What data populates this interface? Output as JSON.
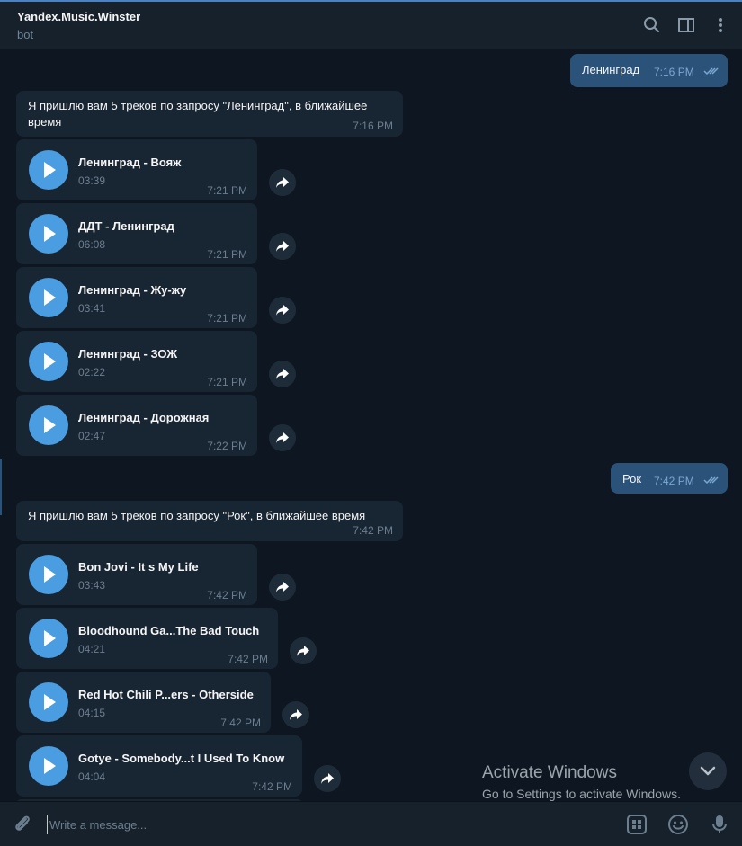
{
  "header": {
    "title": "Yandex.Music.Winster",
    "subtitle": "bot",
    "icons": [
      "search-icon",
      "sidebar-toggle-icon",
      "more-vertical-icon"
    ]
  },
  "messages": {
    "out1": {
      "text": "Ленинград",
      "time": "7:16 PM"
    },
    "in1": {
      "text_line1": "Я пришлю вам 5 треков по запросу \"Ленинград\", в ближайшее",
      "text_line2": "время",
      "time": "7:16 PM"
    },
    "tracks1": [
      {
        "title": "Ленинград - Вояж",
        "duration": "03:39",
        "time": "7:21 PM"
      },
      {
        "title": "ДДТ - Ленинград",
        "duration": "06:08",
        "time": "7:21 PM"
      },
      {
        "title": "Ленинград - Жу-жу",
        "duration": "03:41",
        "time": "7:21 PM"
      },
      {
        "title": "Ленинград - ЗОЖ",
        "duration": "02:22",
        "time": "7:21 PM"
      },
      {
        "title": "Ленинград - Дорожная",
        "duration": "02:47",
        "time": "7:22 PM"
      }
    ],
    "out2": {
      "text": "Рок",
      "time": "7:42 PM"
    },
    "in2": {
      "text": "Я пришлю вам 5 треков по запросу \"Рок\", в ближайшее время",
      "time": "7:42 PM"
    },
    "tracks2": [
      {
        "title": "Bon Jovi - It s My Life",
        "duration": "03:43",
        "time": "7:42 PM"
      },
      {
        "title": "Bloodhound Ga...The Bad Touch",
        "duration": "04:21",
        "time": "7:42 PM"
      },
      {
        "title": "Red Hot Chili P...ers - Otherside",
        "duration": "04:15",
        "time": "7:42 PM"
      },
      {
        "title": "Gotye - Somebody...t I Used To Know",
        "duration": "04:04",
        "time": "7:42 PM"
      }
    ]
  },
  "watermark": {
    "line1": "Activate Windows",
    "line2": "Go to Settings to activate Windows."
  },
  "composer": {
    "placeholder": "Write a message...",
    "icons": [
      "attach-icon",
      "bot-commands-icon",
      "emoji-icon",
      "microphone-icon"
    ]
  },
  "colors": {
    "background": "#0e1621",
    "header": "#17212b",
    "incoming_bubble": "#182533",
    "outgoing_bubble": "#2b5278",
    "play_button": "#4a9de0",
    "accent": "#4d82c2"
  }
}
